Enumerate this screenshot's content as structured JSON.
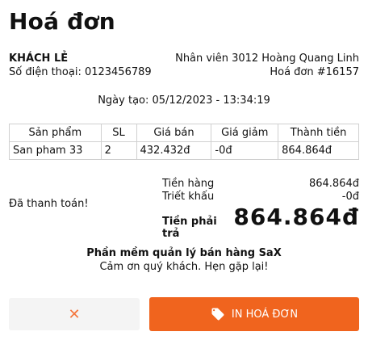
{
  "title": "Hoá đơn",
  "customer": {
    "name": "KHÁCH LẺ",
    "phone": "Số điện thoại: 0123456789"
  },
  "staff": "Nhân viên 3012 Hoàng Quang Linh",
  "invoice_no": "Hoá đơn #16157",
  "created": "Ngày tạo: 05/12/2023 - 13:34:19",
  "table": {
    "headers": [
      "Sản phẩm",
      "SL",
      "Giá bán",
      "Giá giảm",
      "Thành tiền"
    ],
    "rows": [
      [
        "San pham 33",
        "2",
        "432.432đ",
        "-0đ",
        "864.864đ"
      ]
    ]
  },
  "summary": {
    "subtotal_label": "Tiền hàng",
    "subtotal_value": "864.864đ",
    "discount_label": "Triết khấu",
    "discount_value": "-0đ",
    "total_label": "Tiền phải trả",
    "total_value": "864.864đ"
  },
  "payment_status": "Đã thanh toán!",
  "footer": {
    "software": "Phần mềm quản lý bán hàng SaX",
    "thanks": "Cảm ơn quý khách. Hẹn gặp lại!"
  },
  "buttons": {
    "cancel_glyph": "✕",
    "print_label": "IN HOÁ ĐƠN",
    "print_icon": "tag-icon"
  },
  "colors": {
    "accent": "#f0641e",
    "cancel_bg": "#f4f4f4",
    "cancel_icon": "#f4753c"
  }
}
